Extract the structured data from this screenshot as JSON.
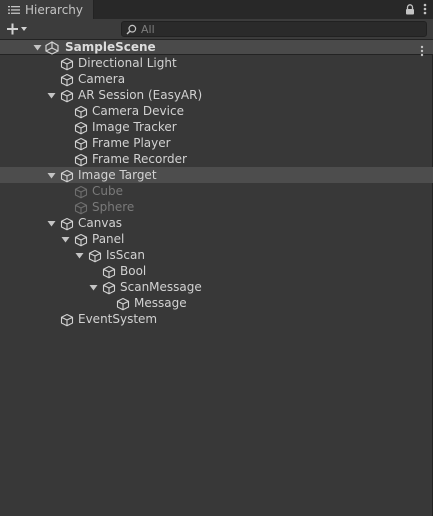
{
  "tab": {
    "label": "Hierarchy"
  },
  "search": {
    "placeholder": "All"
  },
  "scene": {
    "name": "SampleScene"
  },
  "items": [
    {
      "label": "Directional Light"
    },
    {
      "label": "Camera"
    },
    {
      "label": "AR Session (EasyAR)"
    },
    {
      "label": "Camera Device"
    },
    {
      "label": "Image Tracker"
    },
    {
      "label": "Frame Player"
    },
    {
      "label": "Frame Recorder"
    },
    {
      "label": "Image Target"
    },
    {
      "label": "Cube"
    },
    {
      "label": "Sphere"
    },
    {
      "label": "Canvas"
    },
    {
      "label": "Panel"
    },
    {
      "label": "IsScan"
    },
    {
      "label": "Bool"
    },
    {
      "label": "ScanMessage"
    },
    {
      "label": "Message"
    },
    {
      "label": "EventSystem"
    }
  ]
}
